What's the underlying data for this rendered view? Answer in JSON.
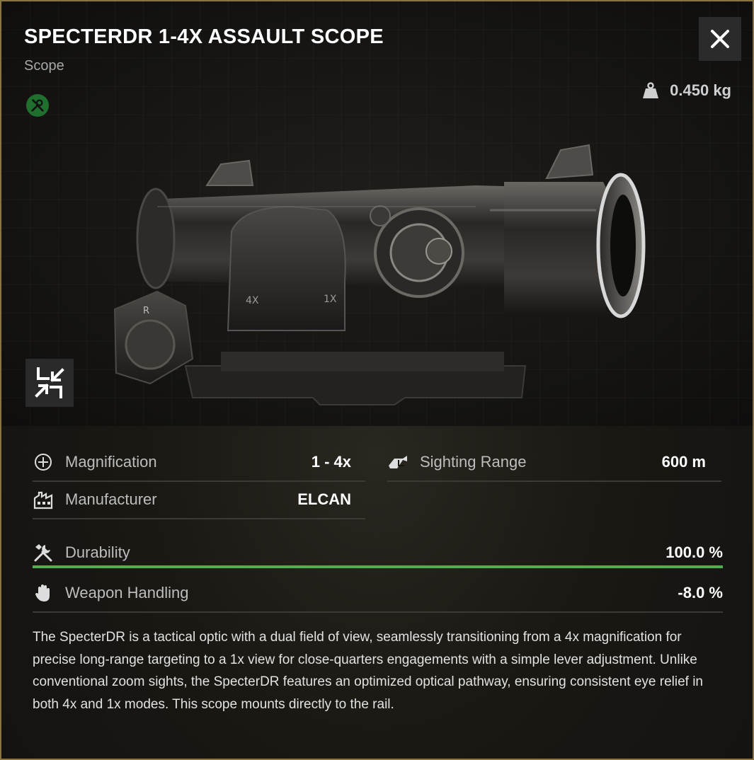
{
  "item": {
    "title": "SPECTERDR 1-4X ASSAULT SCOPE",
    "category": "Scope",
    "weight": "0.450 kg"
  },
  "icons": {
    "close": "close-icon",
    "weight": "weight-icon",
    "repair": "repair-tools-icon",
    "collapse": "collapse-arrows-icon"
  },
  "stats": {
    "magnification": {
      "label": "Magnification",
      "value": "1 - 4x"
    },
    "sighting_range": {
      "label": "Sighting Range",
      "value": "600 m"
    },
    "manufacturer": {
      "label": "Manufacturer",
      "value": "ELCAN"
    },
    "durability": {
      "label": "Durability",
      "value": "100.0 %",
      "fraction": 1.0
    },
    "weapon_handling": {
      "label": "Weapon Handling",
      "value": "-8.0 %"
    }
  },
  "colors": {
    "frame": "#8a7445",
    "durability_bar": "#4caf50",
    "repair_badge": "#1f6f2e"
  },
  "description": "The SpecterDR is a tactical optic with a dual field of view, seamlessly transitioning from a 4x magnification for precise long-range targeting to a 1x view for close-quarters engagements with a simple lever adjustment. Unlike conventional zoom sights, the SpecterDR features an optimized optical pathway, ensuring consistent eye relief in both 4x and 1x modes. This scope mounts directly to the rail."
}
